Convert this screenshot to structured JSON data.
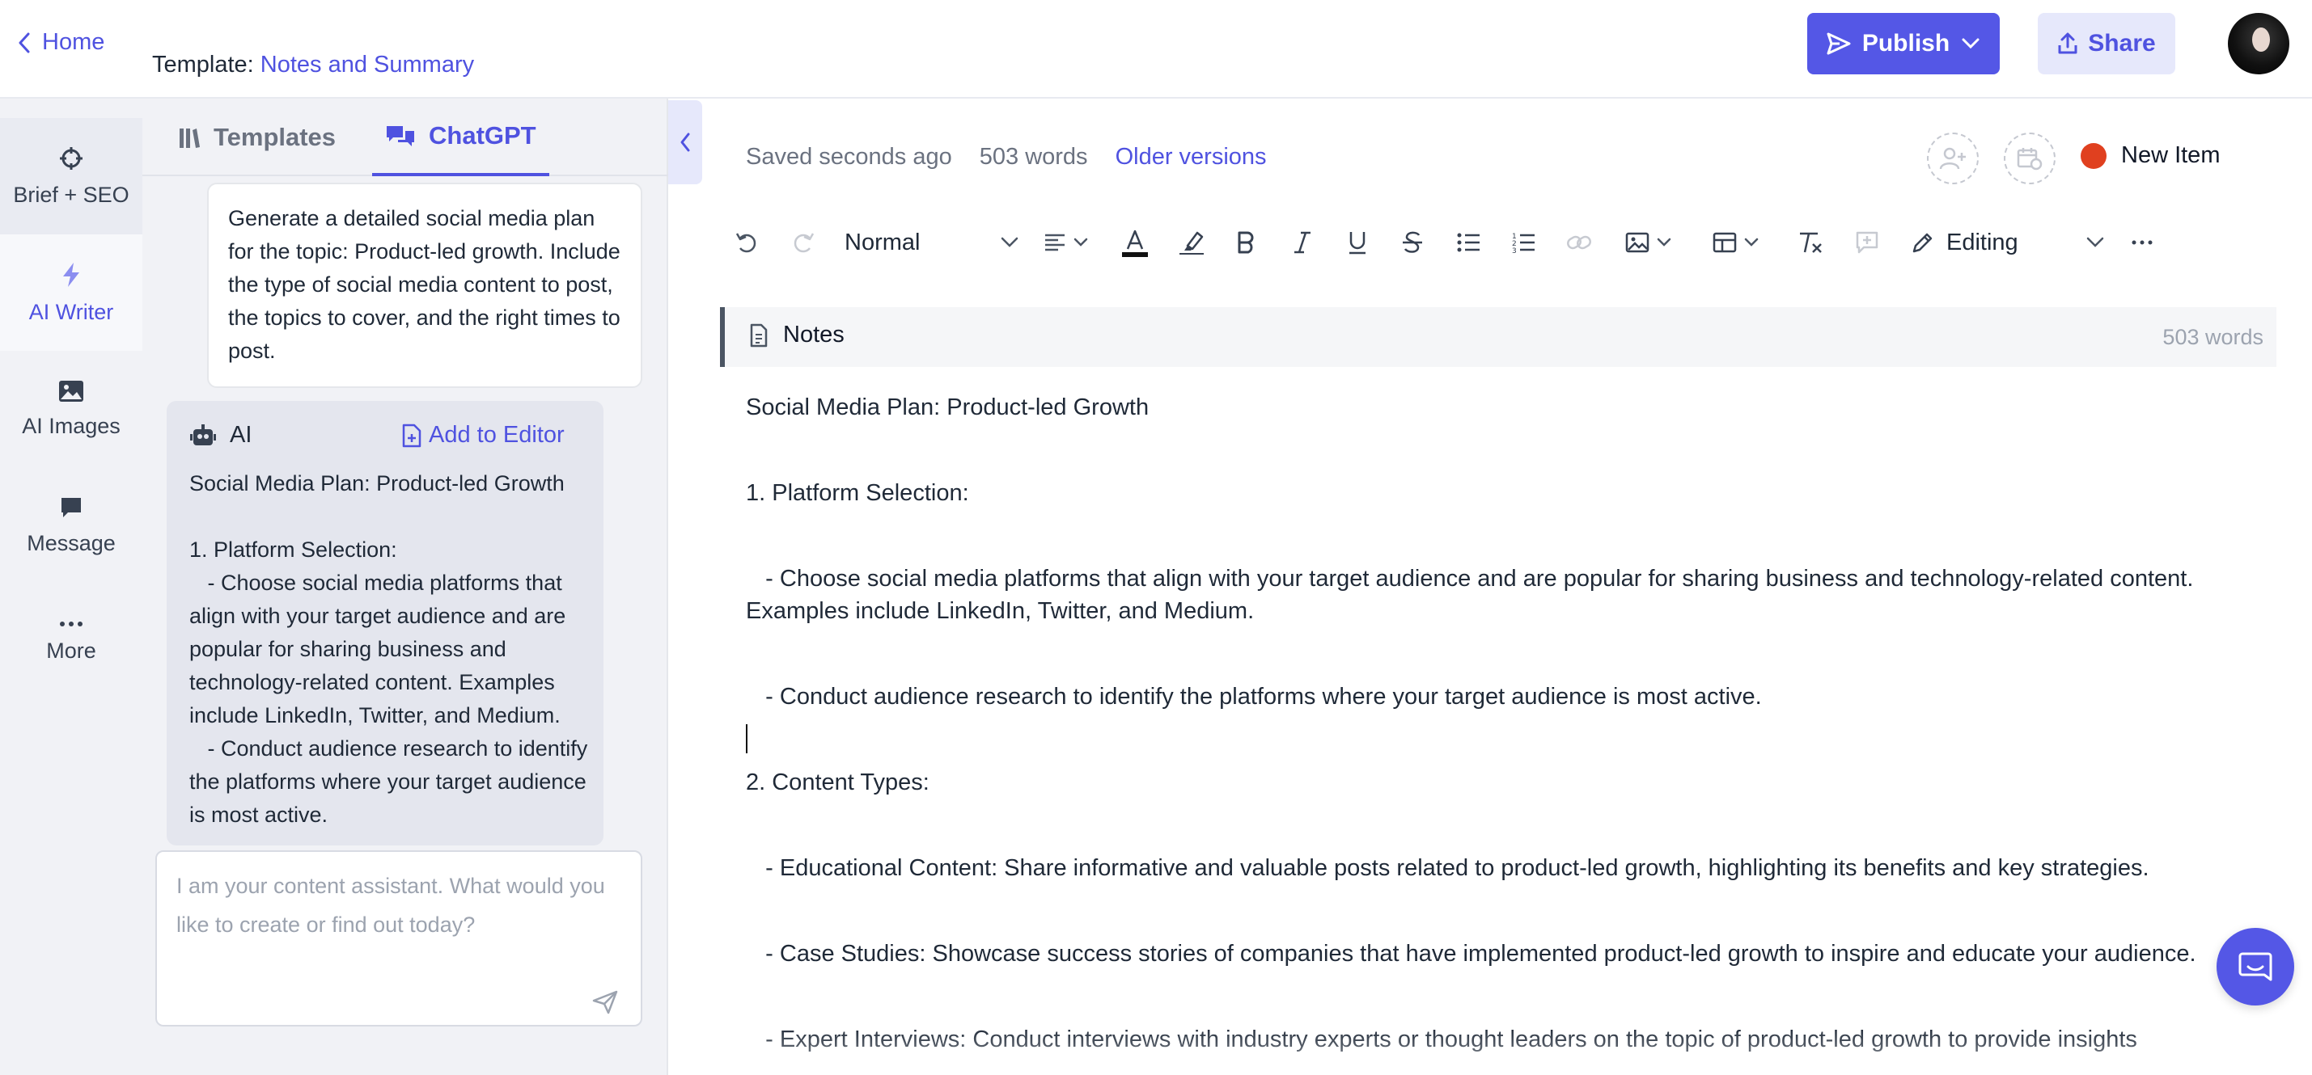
{
  "header": {
    "home_label": "Home",
    "template_prefix": "Template:",
    "template_name": "Notes and Summary",
    "publish_label": "Publish",
    "share_label": "Share"
  },
  "rail": {
    "items": [
      {
        "label": "Brief + SEO",
        "icon": "crosshair-icon"
      },
      {
        "label": "AI Writer",
        "icon": "lightning-icon"
      },
      {
        "label": "AI Images",
        "icon": "image-icon"
      },
      {
        "label": "Message",
        "icon": "message-icon"
      },
      {
        "label": "More",
        "icon": "more-dots-icon"
      }
    ]
  },
  "chat": {
    "tabs": [
      {
        "label": "Templates"
      },
      {
        "label": "ChatGPT"
      }
    ],
    "user_prompt": "Generate a detailed social media plan for the topic: Product-led growth. Include the type of social media content to post, the topics to cover, and the right times to post.",
    "ai_label": "AI",
    "add_to_editor_label": "Add to Editor",
    "ai_response": "Social Media Plan: Product-led Growth\n\n1. Platform Selection:\n   - Choose social media platforms that align with your target audience and are popular for sharing business and technology-related content. Examples include LinkedIn, Twitter, and Medium.\n   - Conduct audience research to identify the platforms where your target audience is most active.",
    "input_placeholder": "I am your content assistant. What would you like to create or find out today?"
  },
  "editor": {
    "status_saved": "Saved seconds ago",
    "status_words": "503 words",
    "older_versions_label": "Older versions",
    "new_item_label": "New Item",
    "toolbar": {
      "style_value": "Normal",
      "mode_value": "Editing"
    },
    "section_title": "Notes",
    "section_words": "503 words",
    "paragraphs": [
      "Social Media Plan: Product-led Growth",
      "1. Platform Selection:",
      "   - Choose social media platforms that align with your target audience and are popular for sharing business and technology-related content. Examples include LinkedIn, Twitter, and Medium.",
      "   - Conduct audience research to identify the platforms where your target audience is most active.",
      "2. Content Types:",
      "   - Educational Content: Share informative and valuable posts related to product-led growth, highlighting its benefits and key strategies.",
      "   - Case Studies: Showcase success stories of companies that have implemented product-led growth to inspire and educate your audience.",
      "   - Expert Interviews: Conduct interviews with industry experts or thought leaders on the topic of product-led growth to provide insights"
    ]
  },
  "colors": {
    "accent": "#5457e6",
    "link": "#4f52e0",
    "status_dot": "#e0401f"
  }
}
